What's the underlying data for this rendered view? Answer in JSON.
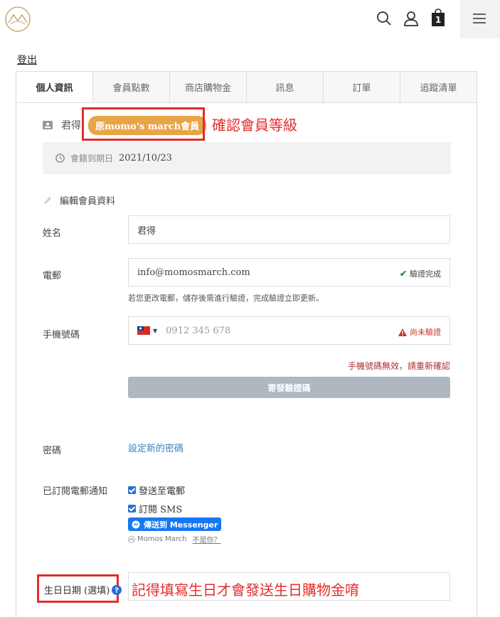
{
  "header": {
    "logo": "mountain-logo-icon",
    "search": "search-icon",
    "user": "user-icon",
    "cart_count": "1",
    "menu": "hamburger-menu-icon"
  },
  "logout_label": "登出",
  "tabs": [
    {
      "label": "個人資訊",
      "active": true
    },
    {
      "label": "會員點數",
      "active": false
    },
    {
      "label": "商店購物金",
      "active": false
    },
    {
      "label": "訊息",
      "active": false
    },
    {
      "label": "訂單",
      "active": false
    },
    {
      "label": "追蹤清單",
      "active": false
    }
  ],
  "member": {
    "name": "君得",
    "tier_badge": "原momo's march會員",
    "annotation": "確認會員等級",
    "expiry_label": "會籍到期日",
    "expiry_value": "2021/10/23"
  },
  "edit_section": {
    "title": "編輯會員資料",
    "name_label": "姓名",
    "name_value": "君得",
    "email_label": "電郵",
    "email_value": "info@momosmarch.com",
    "email_status": "驗證完成",
    "email_hint": "若您更改電郵，儲存後需進行驗證，完成驗證立即更新。",
    "phone_label": "手機號碼",
    "phone_placeholder": "0912 345 678",
    "phone_status": "尚未驗證",
    "phone_error": "手機號碼無效，請重新確認",
    "send_code_label": "寄發驗證碼",
    "password_label": "密碼",
    "password_link": "設定新的密碼",
    "subscribe_label": "已訂閱電郵通知",
    "subscribe_email": "發送至電郵",
    "subscribe_sms": "訂閱 SMS",
    "messenger_button": "傳送到 Messenger",
    "messenger_page": "Momos March",
    "messenger_not_you": "不是你？",
    "birthday_label": "生日日期 (選填)",
    "birthday_annotation": "記得填寫生日才會發送生日購物金唷"
  },
  "colors": {
    "badge": "#e8a547",
    "annotation_red": "#e52b2b",
    "link_blue": "#3b82c4",
    "button_gray": "#aeb8c1",
    "messenger_blue": "#1877f2"
  }
}
